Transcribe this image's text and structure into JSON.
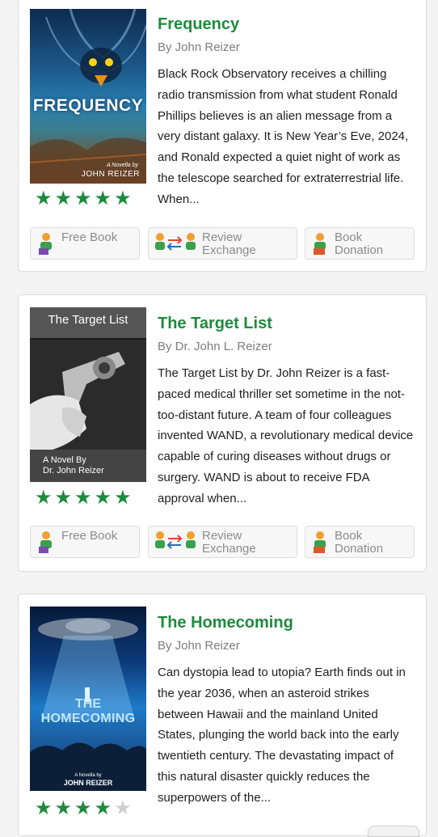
{
  "books": [
    {
      "title": "Frequency",
      "author": "By John Reizer",
      "description": "Black Rock Observatory receives a chilling radio transmission from what student Ronald Phillips believes is an alien message from a very distant galaxy. It is New Year’s Eve, 2024, and Ronald expected a quiet night of work as the telescope searched for extraterrestrial life. When...",
      "rating": 5,
      "cover": {
        "title": "FREQUENCY",
        "tagline": "A Novella by",
        "author": "JOHN REIZER"
      },
      "buttons": {
        "free": "Free Book",
        "review_1": "Review",
        "review_2": "Exchange",
        "donate_1": "Book",
        "donate_2": "Donation"
      }
    },
    {
      "title": "The Target List",
      "author": "By Dr. John L. Reizer",
      "description": "The Target List by Dr. John Reizer is a fast-paced medical thriller set sometime in the not-too-distant future. A team of four colleagues invented WAND, a revolutionary medical device capable of curing diseases without drugs or surgery. WAND is about to receive FDA approval when...",
      "rating": 5,
      "cover": {
        "title": "The Target List",
        "tagline": "A Novel By",
        "author": "Dr. John Reizer"
      },
      "buttons": {
        "free": "Free Book",
        "review_1": "Review",
        "review_2": "Exchange",
        "donate_1": "Book",
        "donate_2": "Donation"
      }
    },
    {
      "title": "The Homecoming",
      "author": "By John Reizer",
      "description": "Can dystopia lead to utopia? Earth finds out in the year 2036, when an asteroid strikes between Hawaii and the mainland United States, plunging the world back into the early twentieth century. The devastating impact of this natural disaster quickly reduces the superpowers of the...",
      "rating": 4,
      "cover": {
        "title_1": "THE",
        "title_2": "HOMECOMING",
        "tagline": "A Novella by",
        "author": "JOHN REIZER"
      }
    }
  ],
  "colors": {
    "accent": "#1f8a3e",
    "muted": "#7d7d7d"
  }
}
